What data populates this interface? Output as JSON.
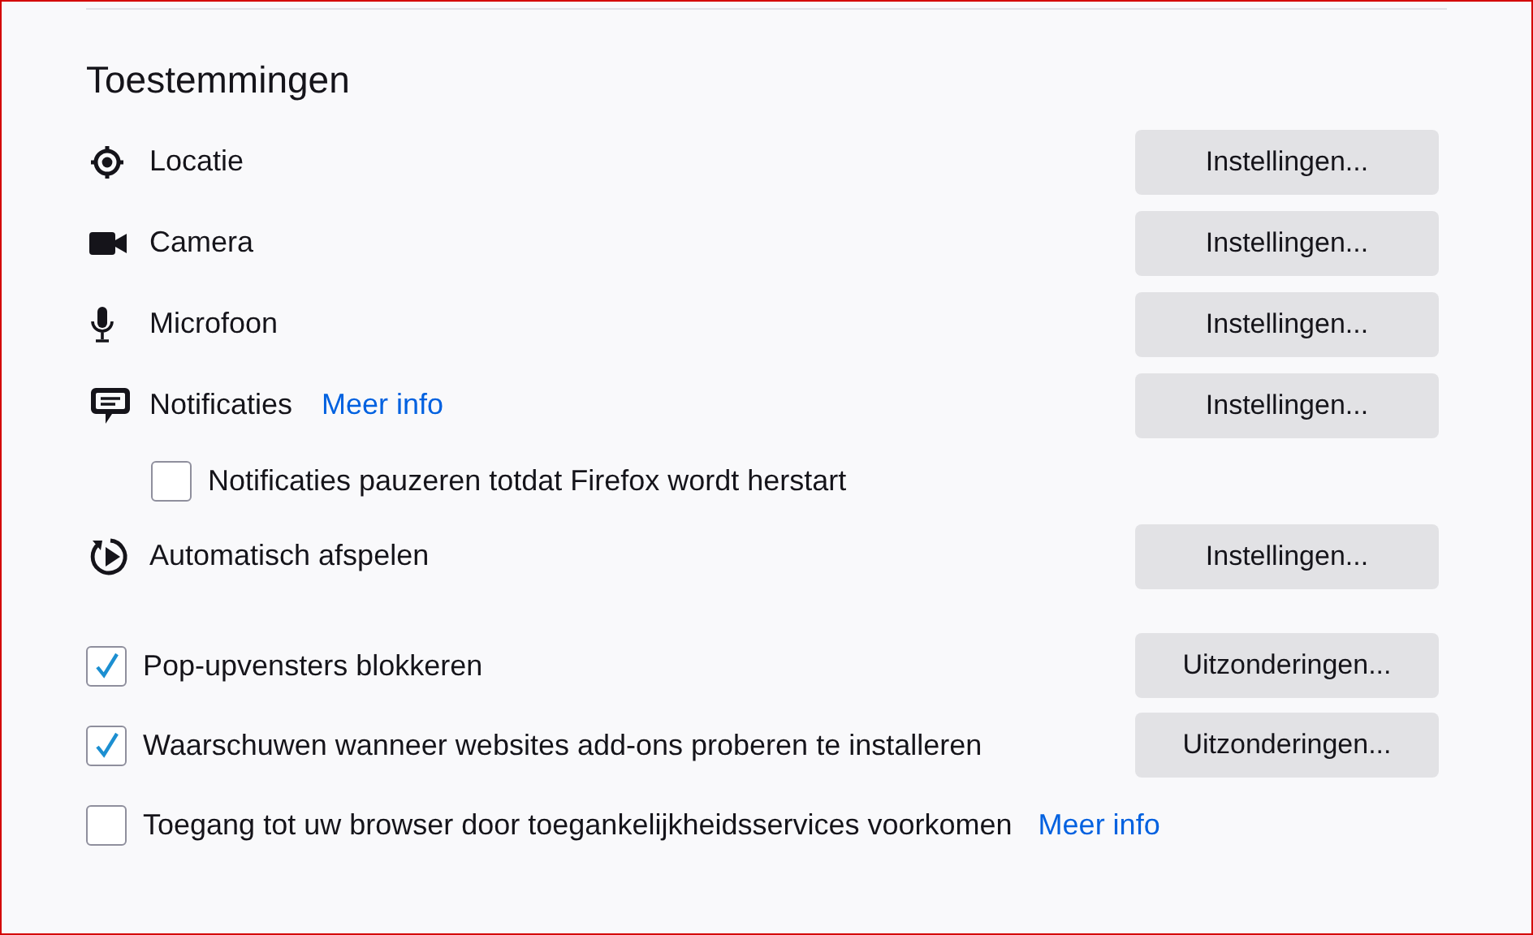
{
  "section": {
    "title": "Toestemmingen"
  },
  "permissions": [
    {
      "kind": "permission",
      "label": "Locatie",
      "button": "Instellingen..."
    },
    {
      "kind": "permission",
      "label": "Camera",
      "button": "Instellingen..."
    },
    {
      "kind": "permission",
      "label": "Microfoon",
      "button": "Instellingen..."
    },
    {
      "kind": "permission",
      "label": "Notificaties",
      "link": "Meer info",
      "button": "Instellingen..."
    },
    {
      "kind": "sub-checkbox",
      "label": "Notificaties pauzeren totdat Firefox wordt herstart",
      "checked": false
    },
    {
      "kind": "permission",
      "label": "Automatisch afspelen",
      "button": "Instellingen..."
    }
  ],
  "options": [
    {
      "label": "Pop-upvensters blokkeren",
      "checked": true,
      "button": "Uitzonderingen..."
    },
    {
      "label": "Waarschuwen wanneer websites add-ons proberen te installeren",
      "checked": true,
      "button": "Uitzonderingen..."
    },
    {
      "label": "Toegang tot uw browser door toegankelijkheidsservices voorkomen",
      "checked": false,
      "link": "Meer info"
    }
  ]
}
